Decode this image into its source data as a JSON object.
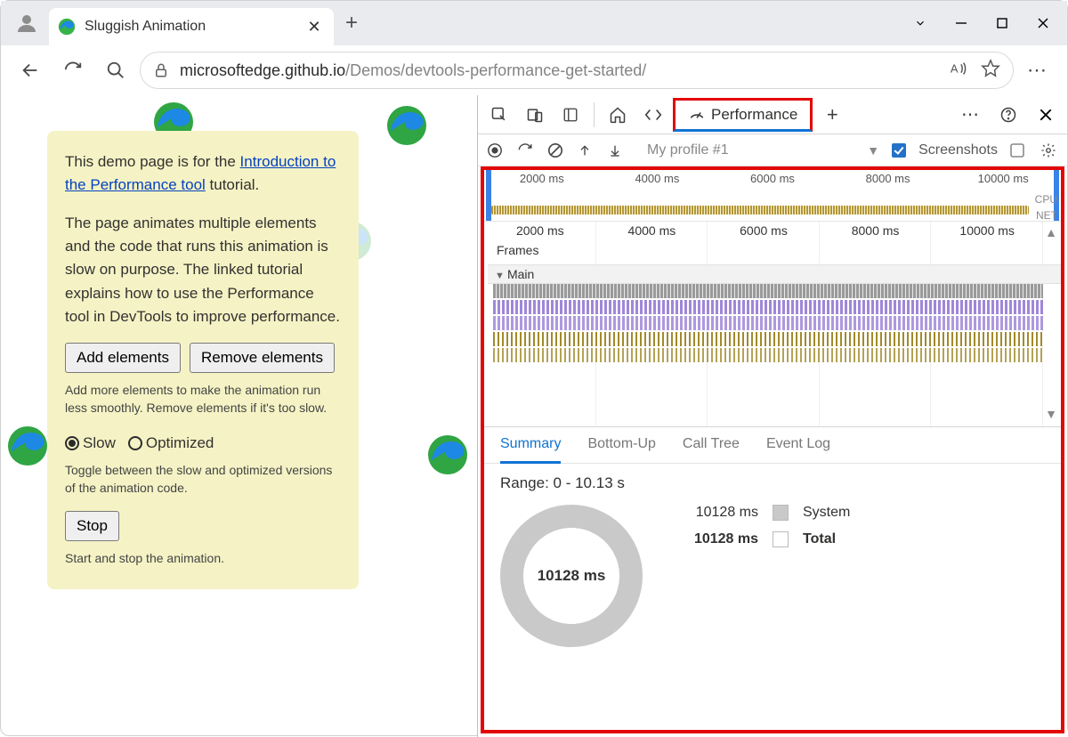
{
  "window": {
    "tab_title": "Sluggish Animation"
  },
  "address": {
    "host": "microsoftedge.github.io",
    "path": "/Demos/devtools-performance-get-started/"
  },
  "demo": {
    "intro_prefix": "This demo page is for the ",
    "intro_link": "Introduction to the Performance tool",
    "intro_suffix": " tutorial.",
    "desc": "The page animates multiple elements and the code that runs this animation is slow on purpose. The linked tutorial explains how to use the Performance tool in DevTools to improve performance.",
    "add_btn": "Add elements",
    "remove_btn": "Remove elements",
    "add_help": "Add more elements to make the animation run less smoothly. Remove elements if it's too slow.",
    "mode_slow": "Slow",
    "mode_opt": "Optimized",
    "mode_help": "Toggle between the slow and optimized versions of the animation code.",
    "stop_btn": "Stop",
    "stop_help": "Start and stop the animation."
  },
  "devtools": {
    "perf_tab": "Performance",
    "profile_name": "My profile #1",
    "screenshots_label": "Screenshots",
    "overview_ticks": [
      "2000 ms",
      "4000 ms",
      "6000 ms",
      "8000 ms",
      "10000 ms"
    ],
    "cpu_label": "CPU",
    "net_label": "NET",
    "detail_ticks": [
      "2000 ms",
      "4000 ms",
      "6000 ms",
      "8000 ms",
      "10000 ms"
    ],
    "frames_label": "Frames",
    "main_label": "Main",
    "summary_tabs": {
      "summary": "Summary",
      "bottom_up": "Bottom-Up",
      "call_tree": "Call Tree",
      "event_log": "Event Log"
    },
    "range_text": "Range: 0 - 10.13 s",
    "donut_center": "10128 ms",
    "legend": {
      "system_val": "10128 ms",
      "system_name": "System",
      "total_val": "10128 ms",
      "total_name": "Total"
    }
  }
}
